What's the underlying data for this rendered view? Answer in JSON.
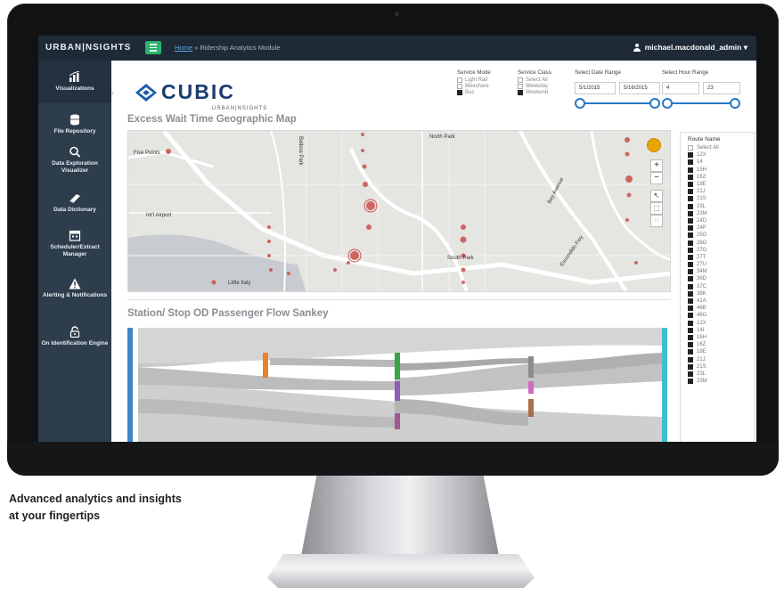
{
  "tagline": {
    "line1": "Advanced analytics and insights",
    "line2": "at your fingertips"
  },
  "topbar": {
    "brand": "URBAN|NSIGHTS",
    "breadcrumb_home": "Home",
    "breadcrumb_rest": " » Ridership Analytics Module",
    "user": "michael.macdonald_admin ▾"
  },
  "sidebar": {
    "items": [
      {
        "label": "Visualizations",
        "icon": "bar-chart-icon"
      },
      {
        "label": "File Repository",
        "icon": "database-icon"
      },
      {
        "label": "Data Exploration Visualizer",
        "icon": "magnifier-icon"
      },
      {
        "label": "Data Dictionary",
        "icon": "book-icon"
      },
      {
        "label": "Scheduler/Extract Manager",
        "icon": "calendar-icon"
      },
      {
        "label": "Alerting & Notifications",
        "icon": "warning-icon"
      },
      {
        "label": "On Identification Engine",
        "icon": "lock-icon"
      }
    ]
  },
  "logo": {
    "word": "CUBIC",
    "sub": "URBAN|NSIGHTS"
  },
  "filters": {
    "service_mode": {
      "title": "Service Mode",
      "options": [
        {
          "label": "Light Rail",
          "checked": false
        },
        {
          "label": "Bikeshare",
          "checked": false
        },
        {
          "label": "Bus",
          "checked": true
        }
      ]
    },
    "service_class": {
      "title": "Service Class",
      "options": [
        {
          "label": "Select All",
          "checked": false
        },
        {
          "label": "Weekday",
          "checked": false
        },
        {
          "label": "Weekend",
          "checked": true
        }
      ]
    },
    "date_range": {
      "title": "Select Date Range",
      "start": "5/1/2015",
      "end": "5/16/2015"
    },
    "hour_range": {
      "title": "Select Hour Range",
      "start": "4",
      "end": "23"
    }
  },
  "map": {
    "title": "Excess Wait Time Geographic Map",
    "labels": [
      "North Park",
      "Five Points",
      "South Park",
      "Little Italy",
      "Balboa Park",
      "Int'l Airport",
      "Bay Avenue",
      "Escondido Fwy"
    ],
    "zoom_in": "+",
    "zoom_out": "−",
    "pin_color": "#e8a400"
  },
  "routes": {
    "title": "Route Name",
    "select_all": "Select All",
    "items": [
      "12X",
      "14",
      "15H",
      "16Z",
      "18E",
      "21J",
      "21S",
      "23L",
      "23M",
      "24D",
      "24P",
      "25G",
      "26G",
      "27G",
      "27T",
      "27U",
      "34M",
      "36D",
      "37C",
      "38K",
      "41A",
      "46B",
      "46G",
      "12X",
      "14I",
      "16H",
      "16Z",
      "18E",
      "21J",
      "21S",
      "23L",
      "23M"
    ]
  },
  "sankey": {
    "title": "Station/ Stop OD Passenger Flow Sankey"
  }
}
